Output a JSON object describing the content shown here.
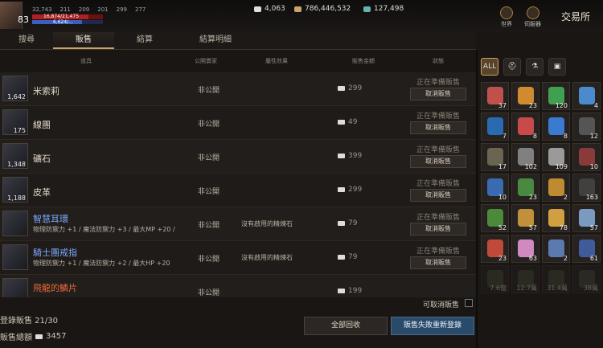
{
  "player": {
    "level": "83",
    "stats": [
      "32,743",
      "211",
      "209",
      "201",
      "299",
      "277"
    ],
    "hp": "16,874/21,475",
    "mp": "6,624/..."
  },
  "currencies": [
    {
      "icon": "diamond-icon",
      "value": "4,063"
    },
    {
      "icon": "adena-icon",
      "value": "786,446,532"
    },
    {
      "icon": "coin-icon",
      "value": "127,498"
    }
  ],
  "topright": {
    "world_label": "世界",
    "server_label": "伺服器",
    "title": "交易所"
  },
  "tabs": [
    "搜尋",
    "販售",
    "結算",
    "結算明細"
  ],
  "active_tab": 1,
  "columns": {
    "item": "道具",
    "public": "公開賣家",
    "effect": "屬性效果",
    "price": "販售金額",
    "status": "狀態"
  },
  "rows": [
    {
      "name": "米索莉",
      "qty": "1,642",
      "public": "非公開",
      "effect": "",
      "price": "299",
      "status": "正在準備販售",
      "cancel": "取消販售"
    },
    {
      "name": "線團",
      "qty": "175",
      "public": "非公開",
      "effect": "",
      "price": "49",
      "status": "正在準備販售",
      "cancel": "取消販售"
    },
    {
      "name": "礦石",
      "qty": "1,348",
      "public": "非公開",
      "effect": "",
      "price": "399",
      "status": "正在準備販售",
      "cancel": "取消販售"
    },
    {
      "name": "皮革",
      "qty": "1,188",
      "public": "非公開",
      "effect": "",
      "price": "299",
      "status": "正在準備販售",
      "cancel": "取消販售"
    },
    {
      "name": "智慧耳環",
      "qty": "",
      "desc": "物理防禦力 +1 / 魔法防禦力 +3 / 最大MP +20 /",
      "public": "非公開",
      "effect": "沒有啟用的精煉石",
      "price": "79",
      "status": "正在準備販售",
      "cancel": "取消販售"
    },
    {
      "name": "騎士團戒指",
      "qty": "",
      "desc": "物理防禦力 +1 / 魔法防禦力 +2 / 最大HP +20",
      "public": "非公開",
      "effect": "沒有啟用的精煉石",
      "price": "79",
      "status": "正在準備販售",
      "cancel": "取消販售"
    },
    {
      "name": "飛龍的鱗片",
      "qty": "",
      "public": "非公開",
      "effect": "",
      "price": "199",
      "status": "",
      "cancel": ""
    }
  ],
  "inventory_tabs": [
    "ALL",
    "helmet-icon",
    "potion-icon",
    "scroll-icon"
  ],
  "inventory": [
    {
      "color": "#c0504a",
      "count": "37"
    },
    {
      "color": "#d08a30",
      "count": "23"
    },
    {
      "color": "#40a050",
      "count": "120"
    },
    {
      "color": "#4a8acd",
      "count": "4"
    },
    {
      "color": "#2a6ab0",
      "count": "7"
    },
    {
      "color": "#c84a4a",
      "count": "8"
    },
    {
      "color": "#3a7ad0",
      "count": "8"
    },
    {
      "color": "#555",
      "count": "12"
    },
    {
      "color": "#6a6450",
      "count": "17"
    },
    {
      "color": "#808080",
      "count": "102"
    },
    {
      "color": "#9a9a9a",
      "count": "109"
    },
    {
      "color": "#8a3a3a",
      "count": "10"
    },
    {
      "color": "#3a6ab0",
      "count": "10"
    },
    {
      "color": "#4a8a40",
      "count": "23"
    },
    {
      "color": "#c08a30",
      "count": "2"
    },
    {
      "color": "#404040",
      "count": "163"
    },
    {
      "color": "#4a8a3a",
      "count": "52"
    },
    {
      "color": "#c0903a",
      "count": "57"
    },
    {
      "color": "#d0a040",
      "count": "78"
    },
    {
      "color": "#7a9ac0",
      "count": "57"
    },
    {
      "color": "#c04a3a",
      "count": "23"
    },
    {
      "color": "#d08ac0",
      "count": "63"
    },
    {
      "color": "#5a7ab0",
      "count": "2"
    },
    {
      "color": "#405a9a",
      "count": "61"
    },
    {
      "color": "#4a5040",
      "count": "7.6億"
    },
    {
      "color": "#4a5040",
      "count": "12.7萬"
    },
    {
      "color": "#4a5040",
      "count": "31.4萬"
    },
    {
      "color": "#4a5040",
      "count": "38萬"
    }
  ],
  "footer": {
    "cancel_toggle": "可取消販售",
    "registered": "登錄販售 21/30",
    "total_label": "販售總額",
    "total_value": "3457",
    "recall_btn": "全部回收",
    "relist_btn": "販售失敗重新登錄"
  }
}
